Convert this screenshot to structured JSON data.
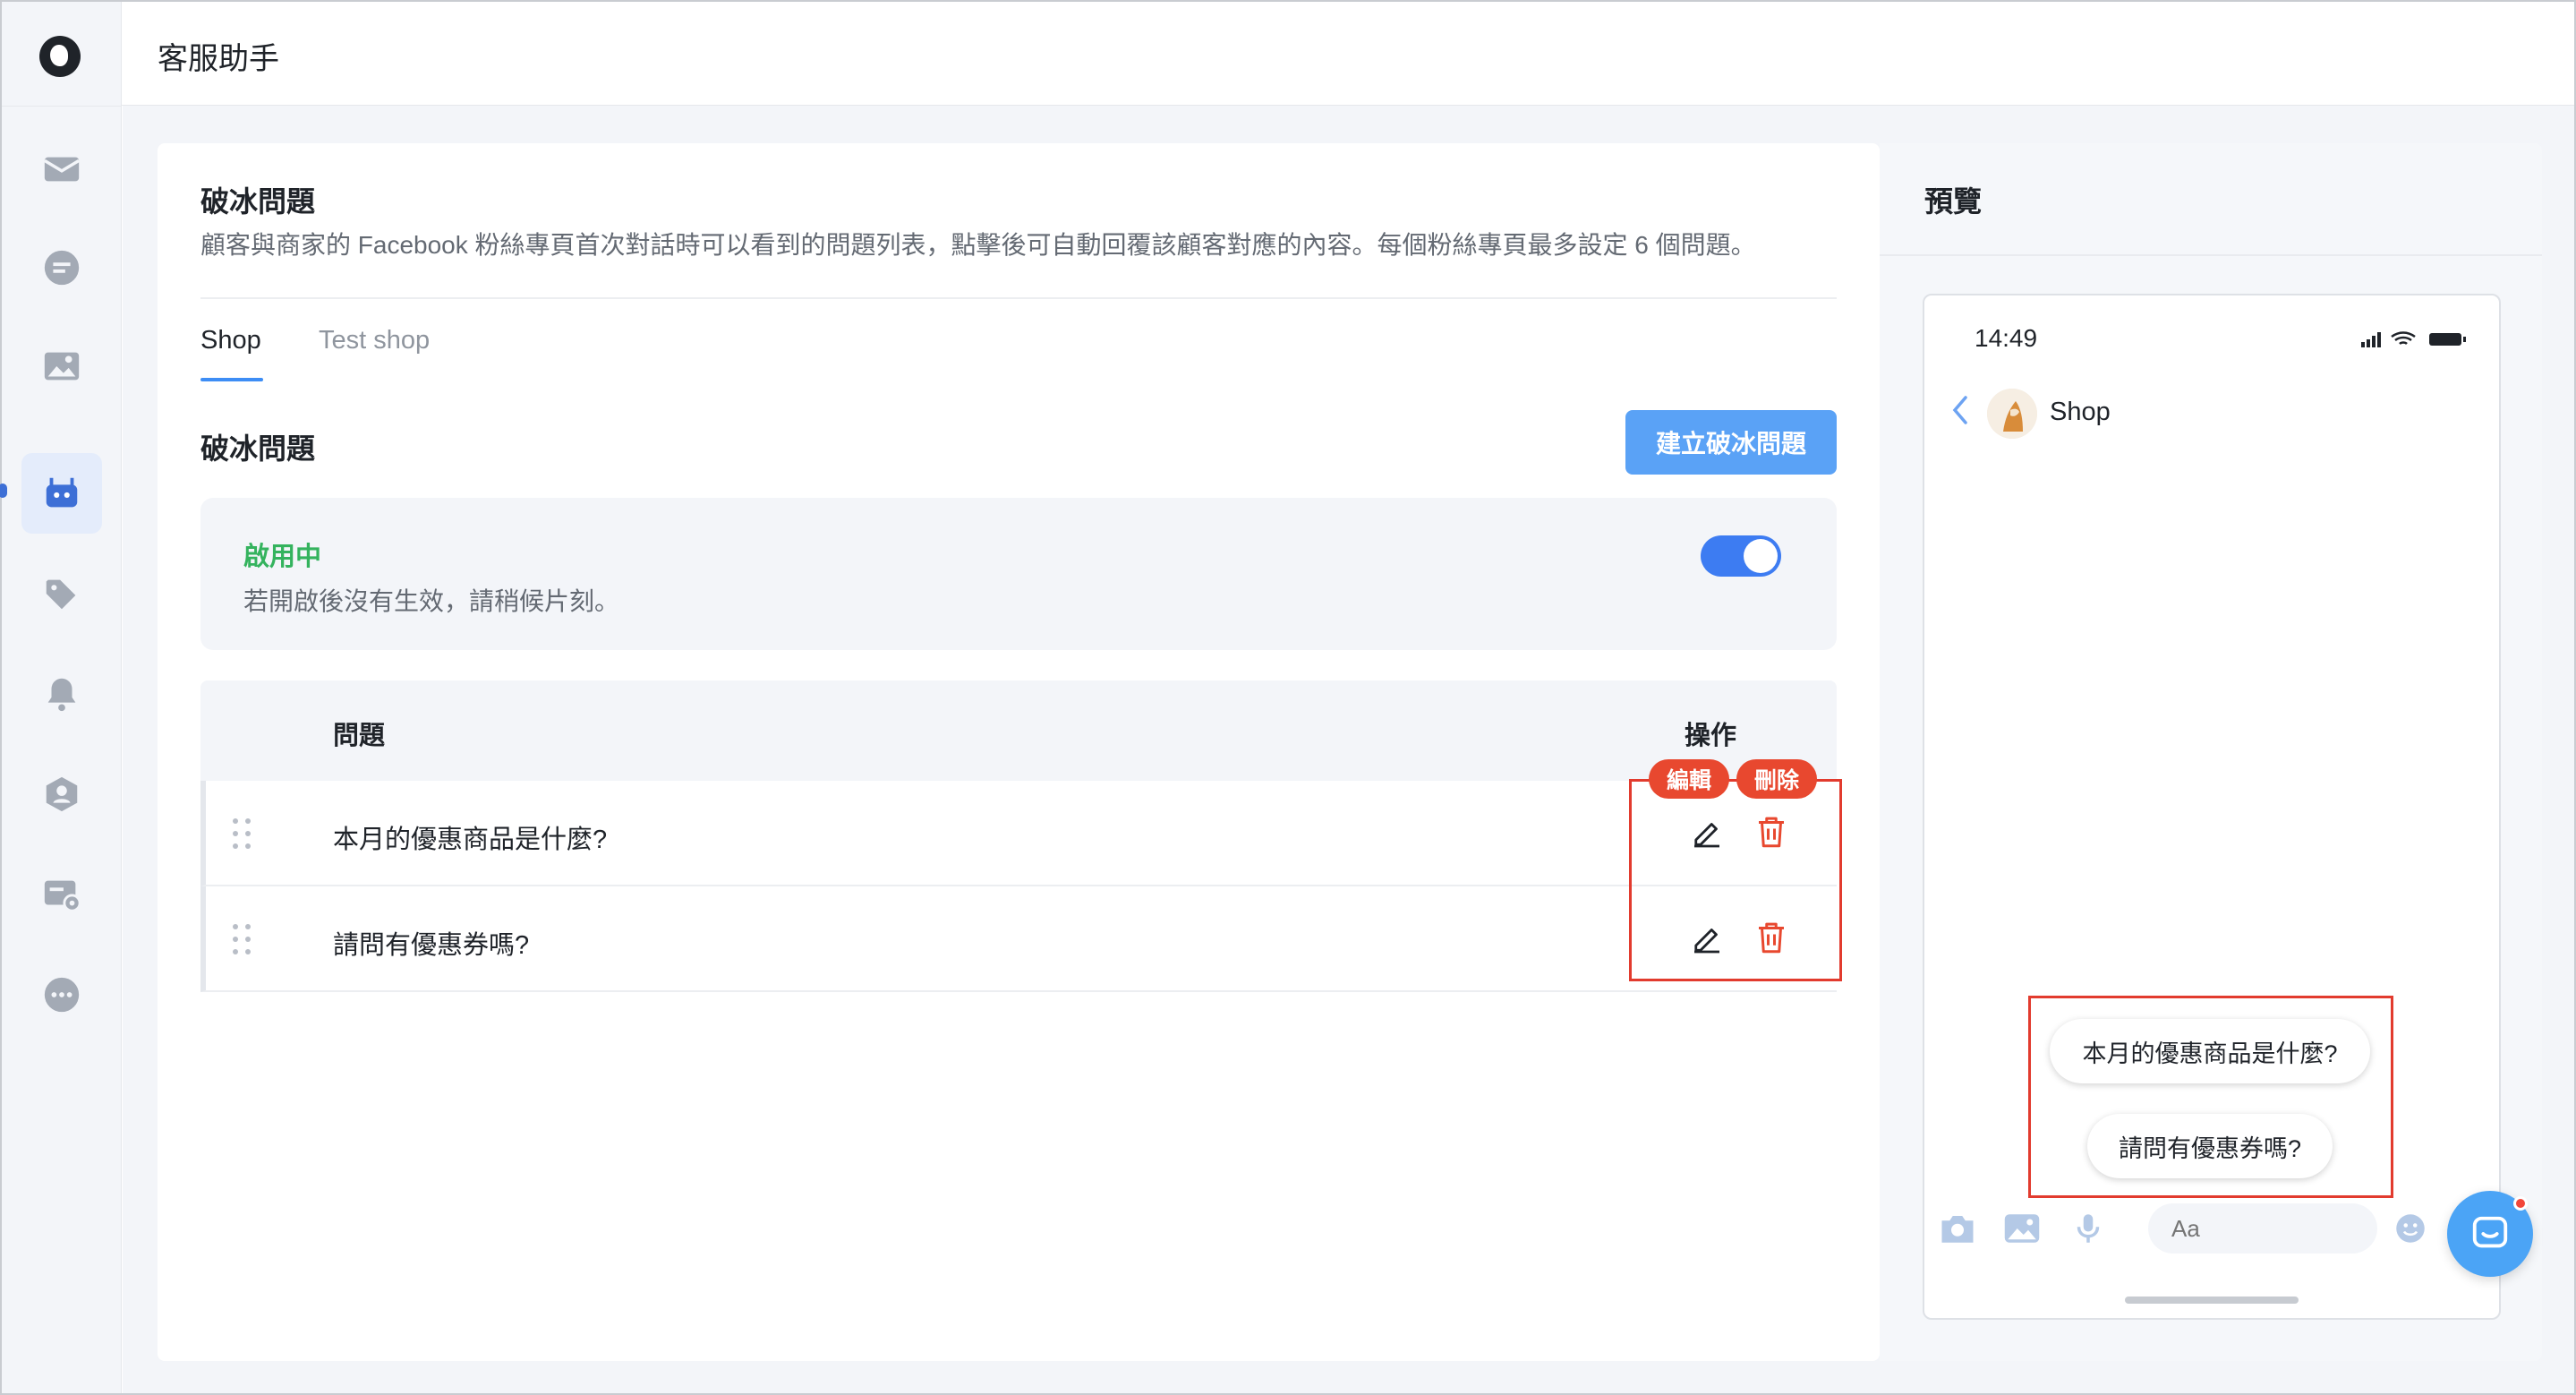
{
  "app": {
    "title": "客服助手"
  },
  "sidebar": {
    "items": [
      {
        "icon": "mail-icon"
      },
      {
        "icon": "chat-icon"
      },
      {
        "icon": "image-icon"
      },
      {
        "icon": "bot-icon",
        "active": true
      },
      {
        "icon": "tag-icon"
      },
      {
        "icon": "bell-icon"
      },
      {
        "icon": "user-shield-icon"
      },
      {
        "icon": "chat-settings-icon"
      },
      {
        "icon": "more-icon"
      }
    ]
  },
  "section": {
    "title": "破冰問題",
    "description": "顧客與商家的 Facebook 粉絲專頁首次對話時可以看到的問題列表，點擊後可自動回覆該顧客對應的內容。每個粉絲專頁最多設定 6 個問題。"
  },
  "tabs": [
    {
      "label": "Shop",
      "active": true
    },
    {
      "label": "Test shop",
      "active": false
    }
  ],
  "list": {
    "title": "破冰問題",
    "create_label": "建立破冰問題"
  },
  "status": {
    "title": "啟用中",
    "hint": "若開啟後沒有生效，請稍候片刻。",
    "enabled": true
  },
  "table": {
    "col_question": "問題",
    "col_actions": "操作",
    "rows": [
      {
        "question": "本月的優惠商品是什麼?"
      },
      {
        "question": "請問有優惠券嗎?"
      }
    ]
  },
  "annotations": {
    "edit_label": "編輯",
    "delete_label": "刪除"
  },
  "preview": {
    "title": "預覽",
    "time": "14:49",
    "page_name": "Shop",
    "quick_replies": [
      "本月的優惠商品是什麼?",
      "請問有優惠券嗎?"
    ],
    "input_placeholder": "Aa"
  },
  "colors": {
    "accent": "#3d7cf2",
    "button": "#5aa2f6",
    "enabled": "#34b35e",
    "danger": "#e8482f",
    "highlight_box": "#e23b2e"
  }
}
